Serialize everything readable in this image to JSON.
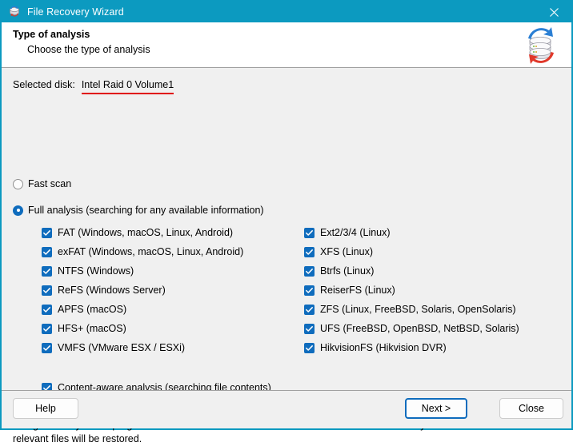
{
  "window": {
    "title": "File Recovery Wizard",
    "app_icon": "disk-stack-icon",
    "close_icon": "close-icon",
    "accent_color": "#0c9ac0",
    "control_accent": "#0f6cbd"
  },
  "header": {
    "title": "Type of analysis",
    "subtitle": "Choose the type of analysis",
    "logo_icon": "disk-recovery-logo"
  },
  "selected_disk": {
    "label": "Selected disk:",
    "value": "Intel Raid 0 Volume1",
    "underline_color": "#e00000"
  },
  "scan_mode": {
    "options": [
      {
        "label": "Fast scan",
        "selected": false
      },
      {
        "label": "Full analysis (searching for any available information)",
        "selected": true
      }
    ]
  },
  "filesystems": {
    "left": [
      {
        "label": "FAT (Windows, macOS, Linux, Android)",
        "checked": true
      },
      {
        "label": "exFAT (Windows, macOS, Linux, Android)",
        "checked": true
      },
      {
        "label": "NTFS (Windows)",
        "checked": true
      },
      {
        "label": "ReFS (Windows Server)",
        "checked": true
      },
      {
        "label": "APFS (macOS)",
        "checked": true
      },
      {
        "label": "HFS+ (macOS)",
        "checked": true
      },
      {
        "label": "VMFS (VMware ESX / ESXi)",
        "checked": true
      }
    ],
    "right": [
      {
        "label": "Ext2/3/4 (Linux)",
        "checked": true
      },
      {
        "label": "XFS (Linux)",
        "checked": true
      },
      {
        "label": "Btrfs (Linux)",
        "checked": true
      },
      {
        "label": "ReiserFS (Linux)",
        "checked": true
      },
      {
        "label": "ZFS (Linux, FreeBSD, Solaris, OpenSolaris)",
        "checked": true
      },
      {
        "label": "UFS (FreeBSD, OpenBSD, NetBSD, Solaris)",
        "checked": true
      },
      {
        "label": "HikvisionFS (Hikvision DVR)",
        "checked": true
      }
    ]
  },
  "content_aware": {
    "label": "Content-aware analysis (searching file contents)",
    "checked": true
  },
  "description": "Using full analysis the program will find all relevant information on a drive and restore a file system. As a result all relevant files will be restored.",
  "footer": {
    "help_label": "Help",
    "next_label": "Next >",
    "close_label": "Close"
  }
}
